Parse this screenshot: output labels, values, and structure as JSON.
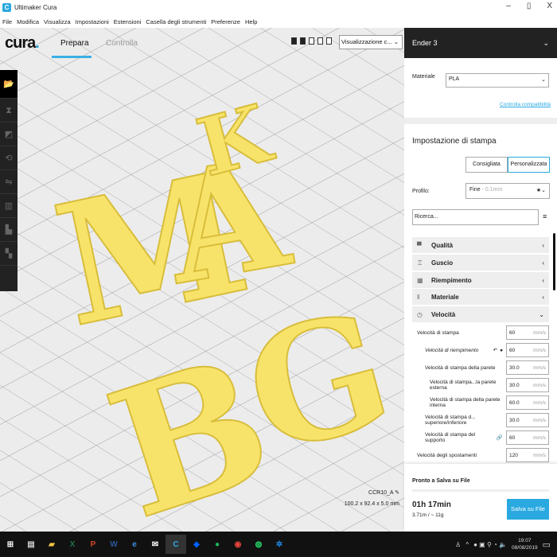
{
  "window": {
    "title": "Ultimaker Cura",
    "app_icon": "C",
    "minimize": "–",
    "maximize": "▯",
    "close": "X"
  },
  "menu": [
    "File",
    "Modifica",
    "Visualizza",
    "Impostazioni",
    "Estensioni",
    "Casella degli strumenti",
    "Preferenze",
    "Help"
  ],
  "header": {
    "logo": "cura",
    "tabs": [
      {
        "label": "Prepara",
        "active": true
      },
      {
        "label": "Controlla",
        "active": false
      }
    ],
    "view_select": "Visualizzazione c...",
    "view_select_chevron": "⌄"
  },
  "viewport": {
    "letters": [
      "M",
      "A",
      "K",
      "B",
      "G"
    ],
    "object_name": "CCR10_A",
    "object_dims": "100.2 x 92.4 x 5.0 mm",
    "object_color": "#f8e36a"
  },
  "panel": {
    "printer": "Ender 3",
    "material_label": "Materiale",
    "material": "PLA",
    "check_link": "Controlla compatibilità",
    "print_settings_title": "Impostazione di stampa",
    "mode_recommended": "Consigliata",
    "mode_custom": "Personalizzata",
    "profile_label": "Profilo:",
    "profile": "Fine",
    "profile_detail": " - 0.1mm",
    "search_placeholder": "Ricerca...",
    "categories": [
      {
        "label": "Qualità",
        "icon": "▀",
        "chev": "‹"
      },
      {
        "label": "Guscio",
        "icon": "♖",
        "chev": "‹"
      },
      {
        "label": "Riempimento",
        "icon": "▦",
        "chev": "‹"
      },
      {
        "label": "Materiale",
        "icon": "‖",
        "chev": "‹"
      },
      {
        "label": "Velocità",
        "icon": "◷",
        "chev": "⌄"
      }
    ],
    "settings": [
      {
        "label": "Velocità di stampa",
        "value": "60",
        "unit": "mm/s"
      },
      {
        "label": "Velocità di riempimento",
        "value": "60",
        "unit": "mm/s"
      },
      {
        "label": "Velocità di stampa della parete",
        "value": "30.0",
        "unit": "mm/s"
      },
      {
        "label": "Velocità di stampa...la parete esterna",
        "value": "30.0",
        "unit": "mm/s"
      },
      {
        "label": "Velocità di stampa della parete interna",
        "value": "60.0",
        "unit": "mm/s"
      },
      {
        "label": "Velocità di stampa d... superiore/inferiore",
        "value": "30.0",
        "unit": "mm/s"
      },
      {
        "label": "Velocità di stampa del supporto",
        "value": "60",
        "unit": "mm/s"
      },
      {
        "label": "Velocità degli spostamenti",
        "value": "120",
        "unit": "mm/s"
      }
    ],
    "status": "Pronto a Salva su File",
    "time": "01h 17min",
    "usage": "3.71m / ~ 11g",
    "save_button": "Salva su File"
  },
  "taskbar": {
    "time": "19:07",
    "date": "08/08/2019"
  }
}
